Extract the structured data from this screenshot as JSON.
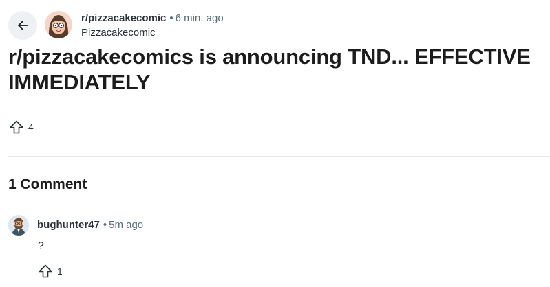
{
  "post": {
    "subreddit": "r/pizzacakecomic",
    "separator": "•",
    "time_ago": "6 min. ago",
    "author_display": "Pizzacakecomic",
    "title": "r/pizzacakecomics is announcing TND... EFFECTIVE IMMEDIATELY",
    "upvotes": "4"
  },
  "comments_section": {
    "heading": "1 Comment"
  },
  "comments": [
    {
      "author": "bughunter47",
      "separator": "•",
      "time_ago": "5m ago",
      "body": "?",
      "upvotes": "1"
    }
  ],
  "icons": {
    "back": "arrow-left-icon",
    "upvote": "upvote-arrow-icon"
  },
  "colors": {
    "text_primary": "#1c1c1c",
    "text_secondary": "#576f76",
    "back_button_bg": "#eef1f3",
    "divider": "#e4e6e8"
  }
}
